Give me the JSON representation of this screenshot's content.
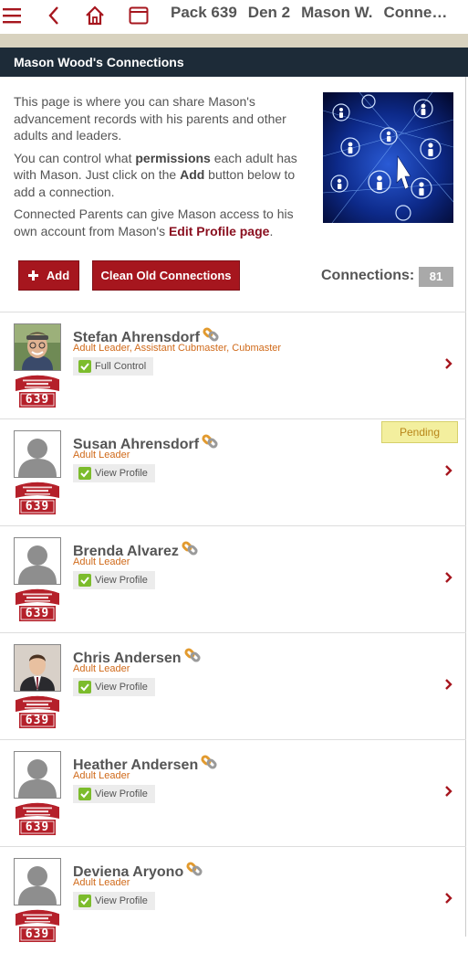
{
  "topbar": {
    "menu_icon": "hamburger-menu-icon",
    "back_icon": "chevron-left-icon",
    "home_icon": "home-icon",
    "window_icon": "browser-window-icon",
    "breadcrumbs": [
      "Pack 639",
      "Den 2",
      "Mason W.",
      "Conne…"
    ]
  },
  "title": "Mason Wood's Connections",
  "intro": {
    "p1": "This page is where you can share Mason's advancement records with his parents and other adults and leaders.",
    "p2_before": "You can control what ",
    "p2_bold1": "permissions",
    "p2_middle": " each adult has with Mason. Just click on the ",
    "p2_bold2": "Add",
    "p2_after": " button below to add a connection.",
    "p3_before": "Connected Parents can give Mason access to his own account from Mason's ",
    "p3_link": "Edit Profile page",
    "p3_after": "."
  },
  "actions": {
    "add_label": "Add",
    "clean_label": "Clean Old Connections",
    "connections_label": "Connections:",
    "connections_count": "81"
  },
  "unit_badge": {
    "council": "CHIEF SEATTLE COUNCIL BSA",
    "state": "WASHINGTON",
    "number": "639"
  },
  "connections": [
    {
      "name": "Stefan Ahrensdorf",
      "roles": "Adult Leader, Assistant Cubmaster, Cubmaster",
      "permission": "Full Control",
      "photo": "photo"
    },
    {
      "name": "Susan Ahrensdorf",
      "roles": "Adult Leader",
      "permission": "View Profile",
      "photo": "placeholder",
      "status": "Pending"
    },
    {
      "name": "Brenda Alvarez",
      "roles": "Adult Leader",
      "permission": "View Profile",
      "photo": "placeholder"
    },
    {
      "name": "Chris Andersen",
      "roles": "Adult Leader",
      "permission": "View Profile",
      "photo": "photo"
    },
    {
      "name": "Heather Andersen",
      "roles": "Adult Leader",
      "permission": "View Profile",
      "photo": "placeholder"
    },
    {
      "name": "Deviena Aryono",
      "roles": "Adult Leader",
      "permission": "View Profile",
      "photo": "placeholder"
    }
  ],
  "colors": {
    "brand_red": "#a6161e",
    "title_bar": "#1d2b38",
    "role_orange": "#d06a1a",
    "check_green": "#7cbc2c",
    "pending_bg": "#f3ef9e"
  }
}
